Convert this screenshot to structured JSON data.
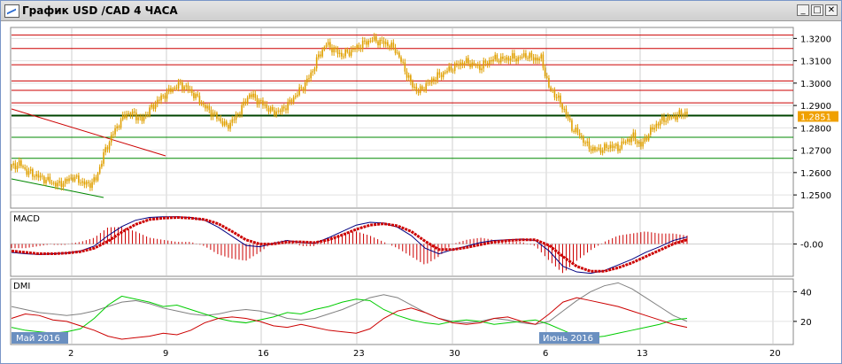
{
  "window": {
    "title": "График USD /CAD  4 ЧАСА",
    "minimize_label": "_",
    "maximize_label": "□",
    "close_label": "✕"
  },
  "colors": {
    "candle": "#e0a000",
    "price_badge": "#f0a000",
    "resistance": "#cc0000",
    "support": "#008800",
    "key_level": "#004400",
    "macd_line": "#000080",
    "macd_signal": "#cc0000",
    "dmi_adx": "#808080",
    "dmi_plus": "#00cc00",
    "dmi_minus": "#cc0000",
    "date_badge": "#6a8fc0"
  },
  "chart_data": [
    {
      "type": "line",
      "name": "USD/CAD",
      "yticks": [
        "1.3200",
        "1.3100",
        "1.3000",
        "1.2900",
        "1.2800",
        "1.2700",
        "1.2600",
        "1.2500"
      ],
      "ylim": [
        1.2445,
        1.3245
      ],
      "current_price": "1.2851",
      "horizontal_levels": {
        "red": [
          1.3215,
          1.3155,
          1.3082,
          1.301,
          1.2968,
          1.2912
        ],
        "dark_green": [
          1.2855
        ],
        "green": [
          1.2758,
          1.2664
        ]
      },
      "x_tick_labels": [
        "2",
        "9",
        "16",
        "23",
        "30",
        "6",
        "13",
        "20"
      ],
      "month_labels": [
        "Май 2016",
        "Июнь 2016"
      ],
      "close": [
        1.2625,
        1.264,
        1.2605,
        1.259,
        1.2575,
        1.256,
        1.2545,
        1.256,
        1.258,
        1.256,
        1.2545,
        1.257,
        1.268,
        1.276,
        1.282,
        1.2865,
        1.286,
        1.2835,
        1.288,
        1.292,
        1.295,
        1.2975,
        1.2995,
        1.2975,
        1.294,
        1.29,
        1.287,
        1.284,
        1.2805,
        1.284,
        1.289,
        1.295,
        1.2925,
        1.29,
        1.287,
        1.2875,
        1.2905,
        1.2945,
        1.2985,
        1.304,
        1.312,
        1.3175,
        1.315,
        1.3125,
        1.314,
        1.316,
        1.318,
        1.3195,
        1.3185,
        1.3175,
        1.315,
        1.308,
        1.3,
        1.296,
        1.299,
        1.302,
        1.304,
        1.306,
        1.308,
        1.3095,
        1.3085,
        1.307,
        1.3095,
        1.311,
        1.3105,
        1.3115,
        1.311,
        1.3125,
        1.311,
        1.311,
        1.298,
        1.294,
        1.288,
        1.28,
        1.277,
        1.272,
        1.27,
        1.2705,
        1.272,
        1.271,
        1.274,
        1.276,
        1.272,
        1.2775,
        1.2815,
        1.284,
        1.2845,
        1.286,
        1.2868
      ]
    },
    {
      "type": "line",
      "name": "MACD",
      "ytick": "-0.00",
      "ylim": [
        -0.0045,
        0.0045
      ],
      "line": [
        -0.0012,
        -0.0014,
        -0.0015,
        -0.0014,
        -0.0013,
        -0.001,
        -0.0003,
        0.0012,
        0.0025,
        0.0034,
        0.0038,
        0.0039,
        0.0039,
        0.0038,
        0.0034,
        0.0024,
        0.0011,
        -0.0002,
        -0.0004,
        0.0001,
        0.0005,
        0.0002,
        0.0001,
        0.0009,
        0.0018,
        0.0027,
        0.0031,
        0.003,
        0.0024,
        0.0012,
        -0.0006,
        -0.0014,
        -0.0008,
        -0.0003,
        0.0002,
        0.0005,
        0.0006,
        0.0007,
        0.0005,
        -0.001,
        -0.0032,
        -0.004,
        -0.0042,
        -0.0038,
        -0.003,
        -0.0022,
        -0.0012,
        -0.0004,
        0.0005,
        0.001
      ],
      "signal": [
        -0.001,
        -0.0012,
        -0.0014,
        -0.0014,
        -0.0013,
        -0.0011,
        -0.0006,
        0.0004,
        0.0017,
        0.0028,
        0.0035,
        0.0037,
        0.0038,
        0.0037,
        0.0035,
        0.0029,
        0.0018,
        0.0006,
        0.0,
        0.0,
        0.0003,
        0.0003,
        0.0002,
        0.0006,
        0.0013,
        0.0021,
        0.0027,
        0.0029,
        0.0026,
        0.0018,
        0.0004,
        -0.0008,
        -0.0008,
        -0.0005,
        -0.0001,
        0.0003,
        0.0005,
        0.0006,
        0.0006,
        -0.0002,
        -0.0018,
        -0.0032,
        -0.0039,
        -0.0039,
        -0.0034,
        -0.0027,
        -0.0018,
        -0.0009,
        0.0,
        0.0006
      ]
    },
    {
      "type": "line",
      "name": "DMI",
      "yticks": [
        "40",
        "20"
      ],
      "ylim": [
        5,
        48
      ],
      "adx": [
        30,
        28,
        26,
        25,
        24,
        25,
        27,
        30,
        33,
        34,
        32,
        29,
        27,
        25,
        24,
        25,
        27,
        28,
        27,
        25,
        22,
        21,
        22,
        25,
        28,
        32,
        36,
        38,
        36,
        31,
        26,
        22,
        20,
        19,
        20,
        22,
        21,
        19,
        18,
        20,
        27,
        34,
        40,
        44,
        46,
        42,
        36,
        30,
        24,
        20
      ],
      "di_plus": [
        16,
        14,
        13,
        12,
        13,
        15,
        22,
        31,
        37,
        35,
        33,
        30,
        31,
        28,
        25,
        22,
        20,
        19,
        21,
        23,
        26,
        25,
        28,
        30,
        33,
        35,
        34,
        28,
        24,
        21,
        19,
        18,
        20,
        21,
        20,
        18,
        19,
        20,
        21,
        18,
        14,
        10,
        9,
        10,
        12,
        14,
        16,
        18,
        21,
        22
      ],
      "di_minus": [
        22,
        25,
        24,
        21,
        20,
        17,
        14,
        10,
        8,
        9,
        10,
        12,
        11,
        14,
        19,
        22,
        23,
        22,
        20,
        17,
        16,
        18,
        16,
        14,
        13,
        12,
        15,
        22,
        27,
        29,
        26,
        22,
        19,
        18,
        19,
        22,
        23,
        20,
        18,
        25,
        33,
        36,
        34,
        32,
        30,
        27,
        24,
        21,
        18,
        16
      ]
    }
  ],
  "macd_panel": {
    "label": "MACD"
  },
  "dmi_panel": {
    "label": "DMI"
  }
}
